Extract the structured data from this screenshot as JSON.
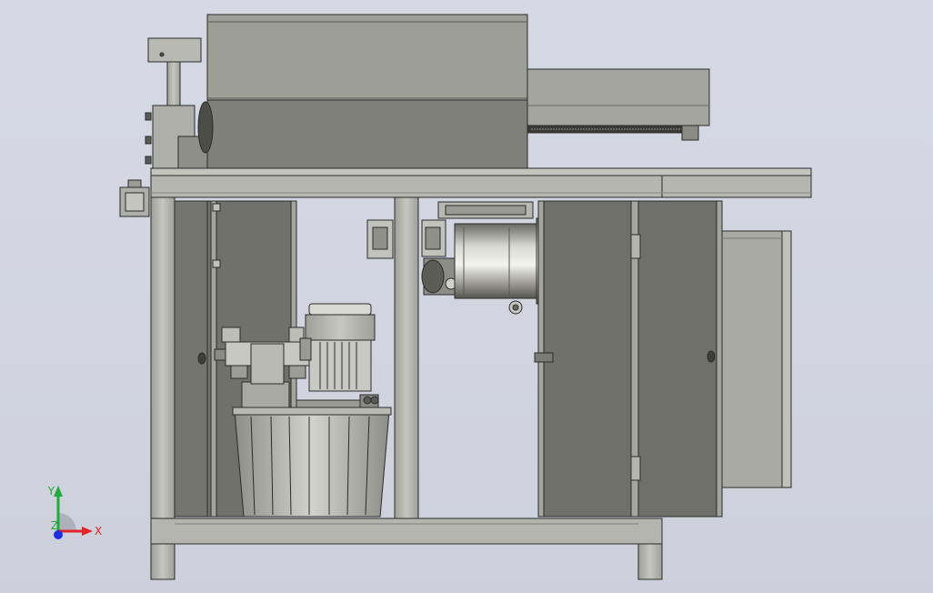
{
  "axis_triad": {
    "x_label": "X",
    "y_label": "Y",
    "z_label": "Z",
    "x_color": "#e0242a",
    "y_color": "#1faa3c",
    "z_color": "#1b2ee0"
  },
  "colors": {
    "background": "#d4d7e2",
    "frame_steel": "#b3b4ad",
    "panel_dark": "#676861",
    "housing": "#9a9b93",
    "outline": "#2b2b2b"
  },
  "parts": {
    "top_housing": "housing",
    "extension_duct": "duct",
    "motor_pump_unit": "motor-pump",
    "hydraulic_station": "hydraulic-station",
    "electrical_cabinet": "cabinet"
  }
}
